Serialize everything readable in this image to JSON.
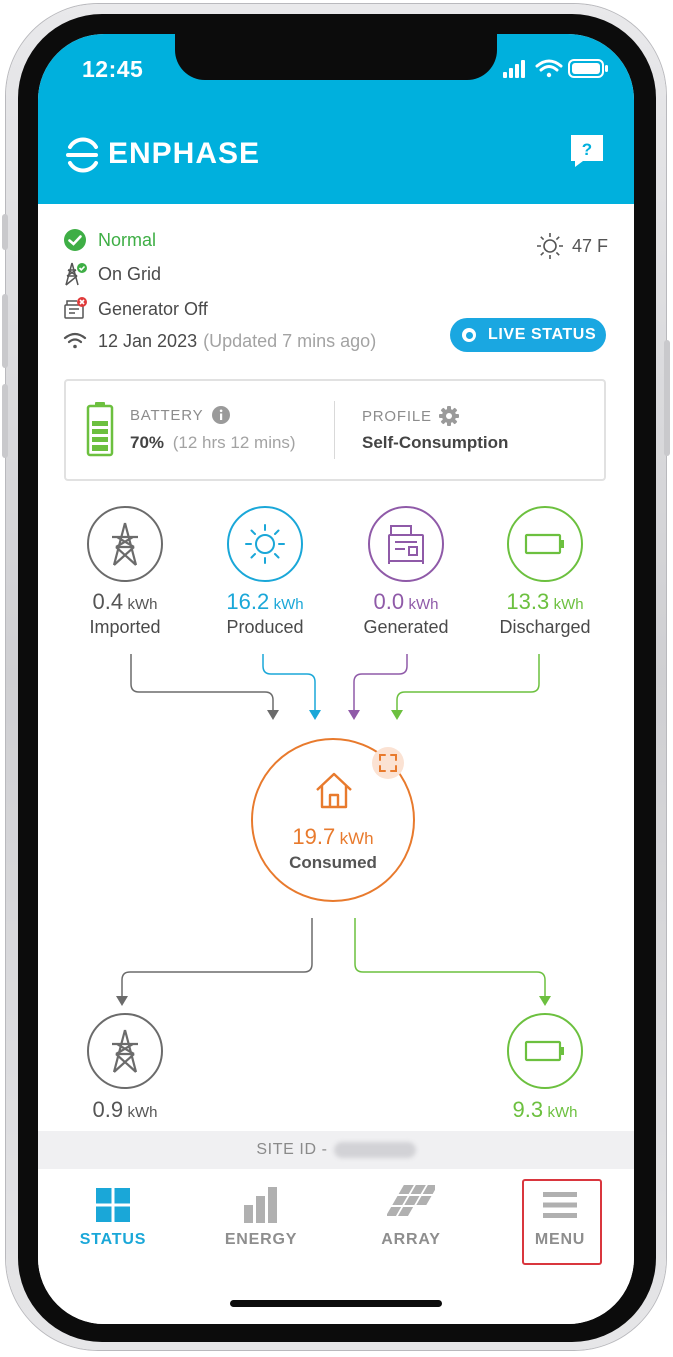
{
  "status_bar": {
    "time": "12:45"
  },
  "header": {
    "brand": "ENPHASE",
    "help_label": "?"
  },
  "system_status": {
    "normal": "Normal",
    "grid": "On Grid",
    "generator": "Generator Off",
    "date": "12 Jan 2023",
    "updated": "(Updated 7 mins ago)",
    "weather": "47 F",
    "live_status": "LIVE STATUS"
  },
  "battery_card": {
    "battery_caption": "BATTERY",
    "battery_percent": "70%",
    "battery_time": "(12 hrs 12 mins)",
    "profile_caption": "PROFILE",
    "profile_value": "Self-Consumption"
  },
  "flow_sources": [
    {
      "value": "0.4",
      "unit": "kWh",
      "label": "Imported",
      "icon": "grid-tower-icon",
      "color": "#6b6b6b"
    },
    {
      "value": "16.2",
      "unit": "kWh",
      "label": "Produced",
      "icon": "sun-icon",
      "color": "#1aa7d8"
    },
    {
      "value": "0.0",
      "unit": "kWh",
      "label": "Generated",
      "icon": "generator-icon",
      "color": "#8f5aa8"
    },
    {
      "value": "13.3",
      "unit": "kWh",
      "label": "Discharged",
      "icon": "battery-icon",
      "color": "#6cc03f"
    }
  ],
  "consumed": {
    "value": "19.7",
    "unit": "kWh",
    "label": "Consumed",
    "icon": "home-icon",
    "color": "#e87a2d"
  },
  "flow_destinations": [
    {
      "value": "0.9",
      "unit": "kWh",
      "icon": "grid-tower-icon",
      "color": "#6b6b6b"
    },
    {
      "value": "9.3",
      "unit": "kWh",
      "icon": "battery-icon",
      "color": "#6cc03f"
    }
  ],
  "site": {
    "label": "SITE ID -"
  },
  "nav": {
    "status": "STATUS",
    "energy": "ENERGY",
    "array": "ARRAY",
    "menu": "MENU",
    "active_color": "#1aa7d8"
  }
}
